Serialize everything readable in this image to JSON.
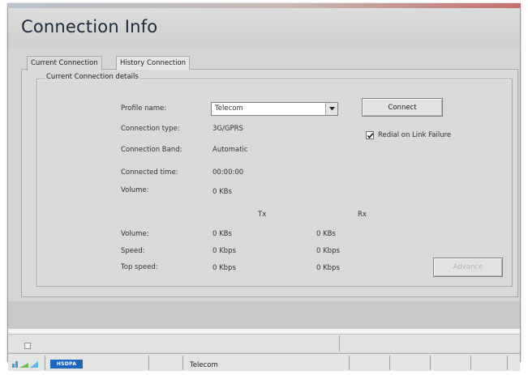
{
  "window": {
    "title": "Connection Info"
  },
  "tabs": [
    {
      "label": "Current Connection",
      "active": true
    },
    {
      "label": "History Connection",
      "active": false
    }
  ],
  "current_connection": {
    "group_label": "Current Connection details",
    "profile_label": "Profile name:",
    "profile_value": "Telecom",
    "connect_label": "Connect",
    "redial_label": "Redial on Link Failure",
    "redial_checked": true,
    "details": [
      {
        "label": "Connection type:",
        "value": "3G/GPRS"
      },
      {
        "label": "Connection Band:",
        "value": "Automatic"
      },
      {
        "label": "Connected time:",
        "value": "00:00:00"
      },
      {
        "label": "Volume:",
        "value": "0 KBs"
      }
    ],
    "tx_header": "Tx",
    "rx_header": "Rx",
    "stats": [
      {
        "label": "Volume:",
        "tx": "0 KBs",
        "rx": "0 KBs"
      },
      {
        "label": "Speed:",
        "tx": "0 Kbps",
        "rx": "0 Kbps"
      },
      {
        "label": "Top speed:",
        "tx": "0 Kbps",
        "rx": "0 Kbps"
      }
    ],
    "advance_label": "Advance"
  },
  "taskbar": {
    "network_type": "HSDPA",
    "profile": "Telecom"
  },
  "icons": {
    "dropdown": "chevron-down-icon",
    "checkbox": "checkmark-icon",
    "signal": "signal-strength-icon"
  },
  "colors": {
    "accent": "#1d66c1",
    "title_text": "#1d2a3a",
    "window_bg": "#d4d4d4"
  }
}
